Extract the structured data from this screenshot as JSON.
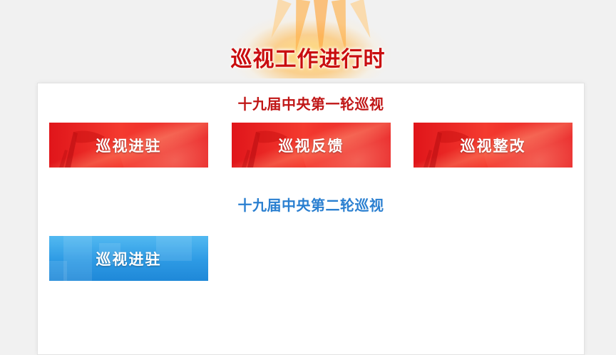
{
  "header": {
    "title": "巡视工作进行时"
  },
  "sections": [
    {
      "title": "十九届中央第一轮巡视",
      "color": "#c01616",
      "buttons": [
        {
          "label": "巡视进驻",
          "theme": "red"
        },
        {
          "label": "巡视反馈",
          "theme": "red"
        },
        {
          "label": "巡视整改",
          "theme": "red"
        }
      ]
    },
    {
      "title": "十九届中央第二轮巡视",
      "color": "#2a7fd0",
      "buttons": [
        {
          "label": "巡视进驻",
          "theme": "blue"
        }
      ]
    }
  ],
  "colors": {
    "title_red": "#c90d0f",
    "button_red": "#e0151a",
    "button_blue": "#2d9ae4",
    "background": "#f1f1f1",
    "panel": "#ffffff"
  }
}
